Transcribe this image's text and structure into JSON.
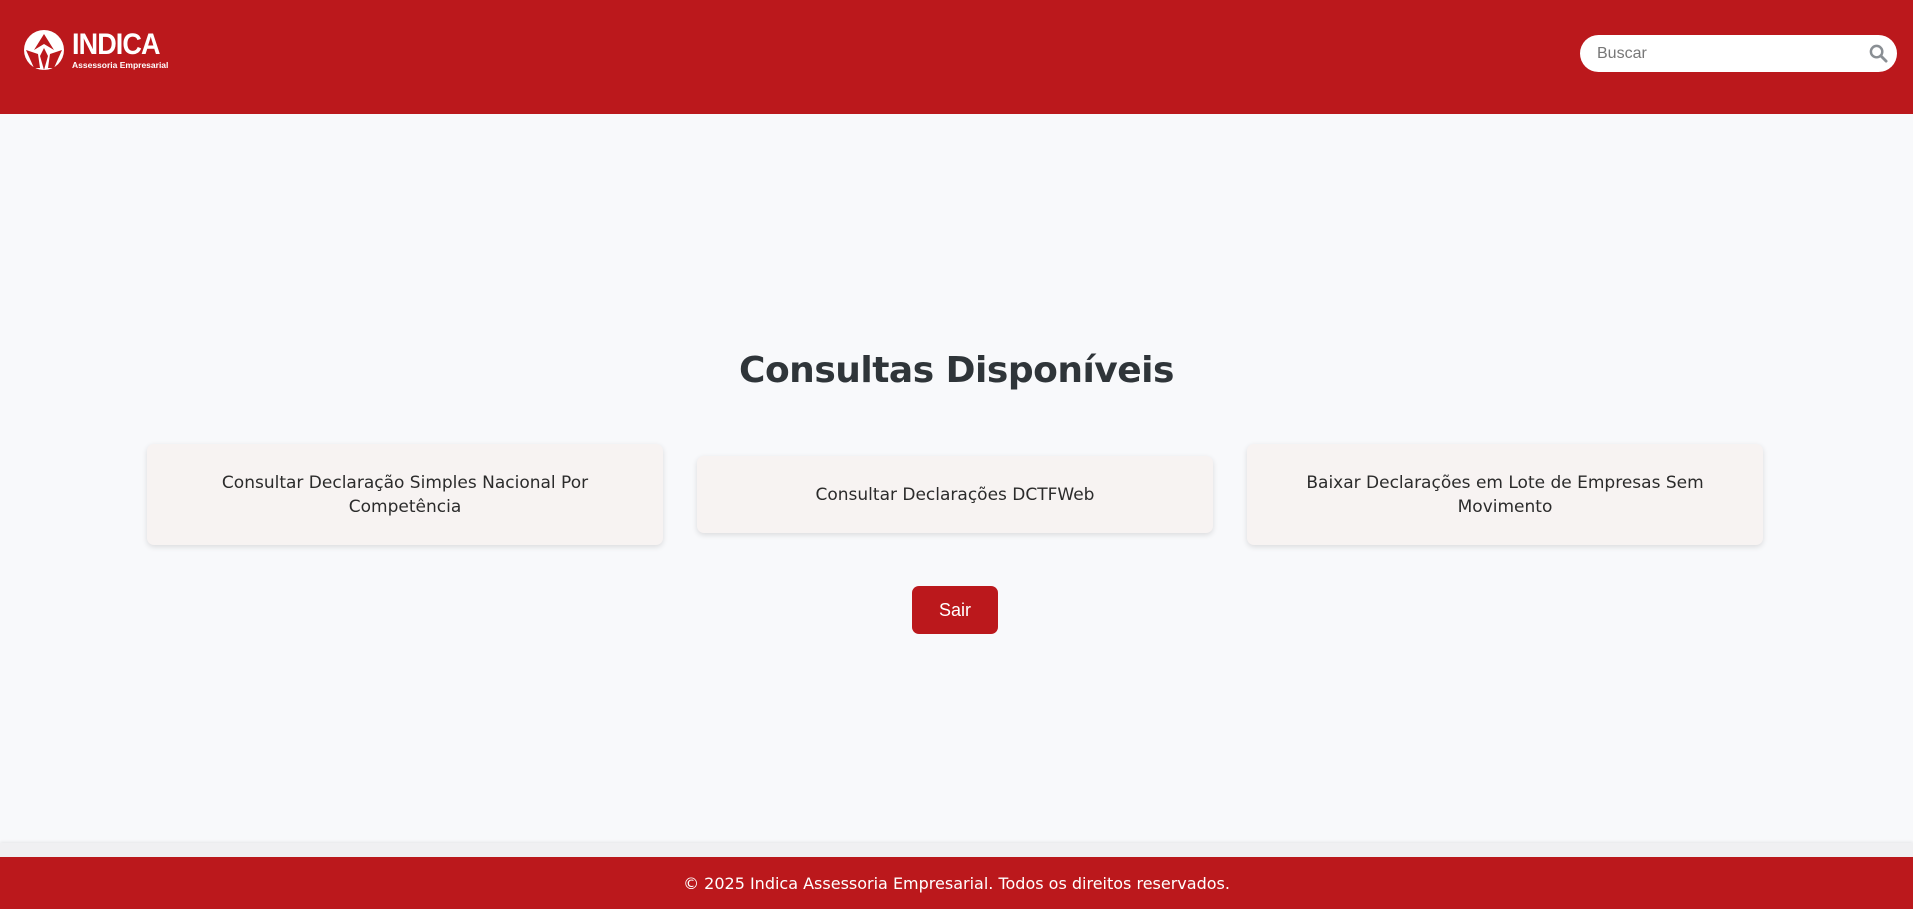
{
  "header": {
    "logo": {
      "name": "INDICA",
      "subtitle": "Assessoria Empresarial",
      "icon": "indica-logo-mark"
    },
    "search": {
      "placeholder": "Buscar",
      "value": "",
      "icon": "search-icon"
    }
  },
  "main": {
    "title": "Consultas Disponíveis",
    "cards": [
      {
        "label": "Consultar Declaração Simples Nacional Por Competência"
      },
      {
        "label": "Consultar Declarações DCTFWeb"
      },
      {
        "label": "Baixar Declarações em Lote de Empresas Sem Movimento"
      }
    ],
    "logout_label": "Sair"
  },
  "footer": {
    "text": "© 2025 Indica Assessoria Empresarial. Todos os direitos reservados."
  },
  "colors": {
    "brand_red": "#bb181c",
    "page_bg": "#f8f9fb",
    "card_bg": "#f7f3f2",
    "title_text": "#2f3539"
  }
}
